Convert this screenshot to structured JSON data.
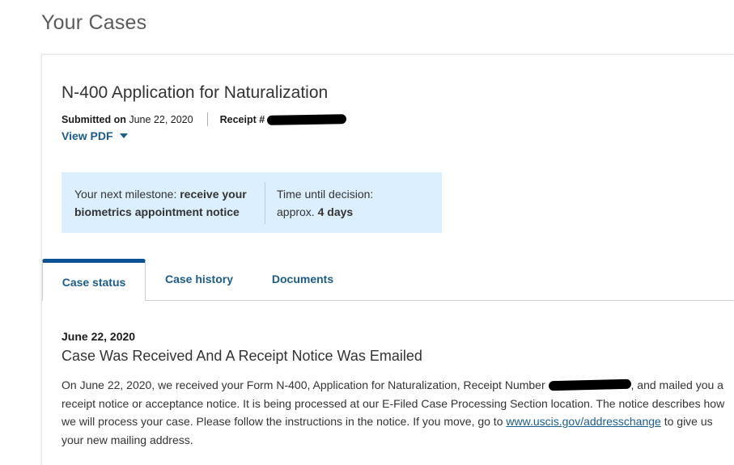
{
  "page": {
    "title": "Your Cases"
  },
  "case": {
    "title": "N-400 Application for Naturalization",
    "submitted_label": "Submitted on",
    "submitted_date": "June 22, 2020",
    "receipt_label": "Receipt #",
    "view_pdf_label": "View PDF"
  },
  "milestone": {
    "prefix": "Your next milestone: ",
    "milestone_bold": "receive your biometrics appointment notice",
    "time_label": "Time until decision:",
    "time_prefix": "approx. ",
    "time_value": "4 days"
  },
  "tabs": [
    {
      "label": "Case status",
      "active": true
    },
    {
      "label": "Case history",
      "active": false
    },
    {
      "label": "Documents",
      "active": false
    }
  ],
  "status": {
    "date": "June 22, 2020",
    "heading": "Case Was Received And A Receipt Notice Was Emailed",
    "body_part1": "On June 22, 2020, we received your Form N-400, Application for Naturalization, Receipt Number ",
    "body_part2": ", and mailed you a receipt notice or acceptance notice. It is being processed at our E-Filed Case Processing Section location. The notice describes how we will process your case. Please follow the instructions in the notice. If you move, go to ",
    "link_text": "www.uscis.gov/addresschange",
    "body_part3": " to give us your new mailing address."
  },
  "colors": {
    "link": "#1a5c8a",
    "tab_active_border": "#0b5394",
    "milestone_bg": "#dcefff"
  },
  "icons": {
    "view_pdf": "caret-down-icon"
  }
}
